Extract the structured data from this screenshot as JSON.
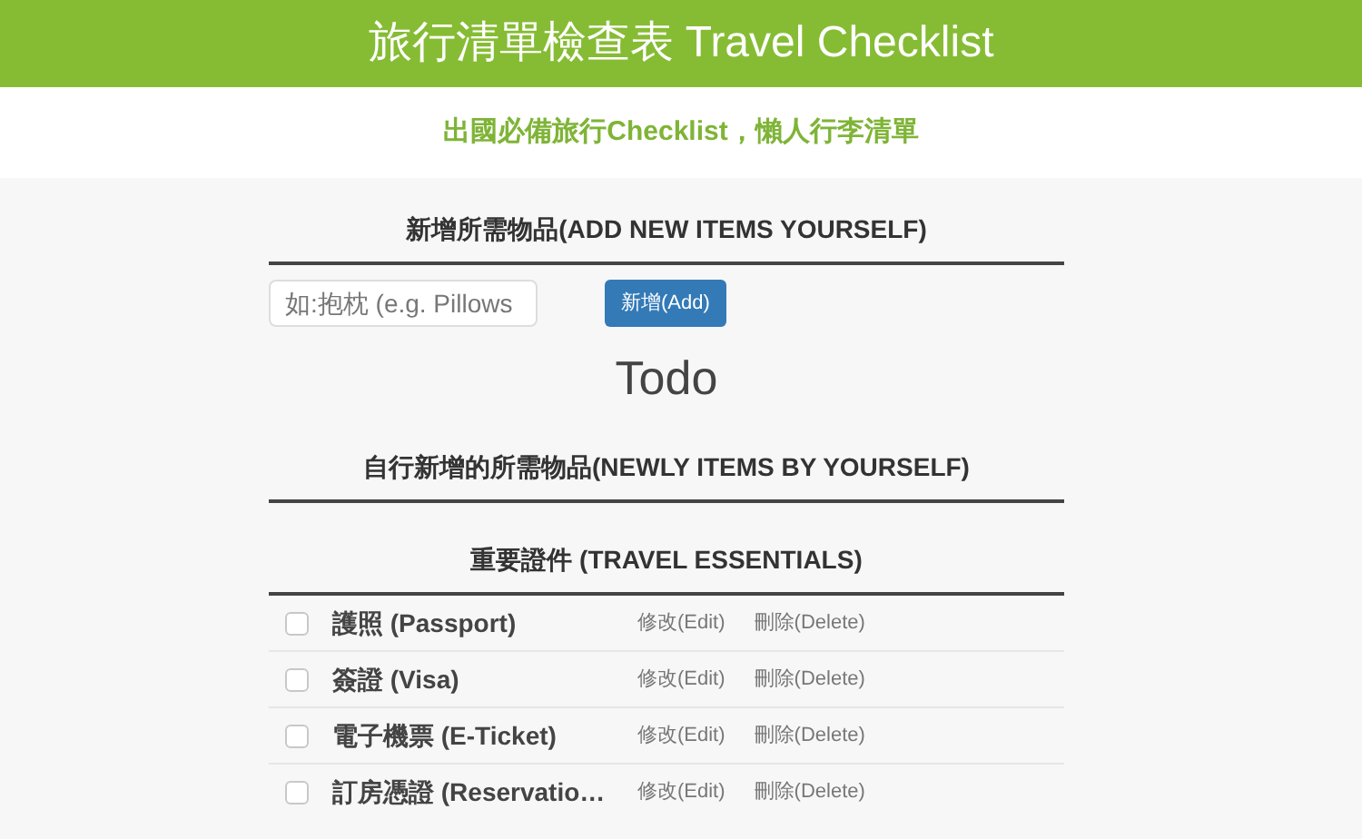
{
  "header": {
    "title": "旅行清單檢查表 Travel Checklist",
    "subtitle": "出國必備旅行Checklist，懶人行李清單"
  },
  "add_section": {
    "heading": "新增所需物品(ADD NEW ITEMS YOURSELF)",
    "input": {
      "placeholder": "如:抱枕 (e.g. Pillows"
    },
    "button": "新增(Add)"
  },
  "todo_title": "Todo",
  "custom_section": {
    "heading": "自行新增的所需物品(NEWLY ITEMS BY YOURSELF)"
  },
  "essentials": {
    "heading": "重要證件 (TRAVEL ESSENTIALS)",
    "items": [
      {
        "name": "護照 (Passport)",
        "checked": false,
        "edit": "修改(Edit)",
        "delete": "刪除(Delete)"
      },
      {
        "name": "簽證 (Visa)",
        "checked": false,
        "edit": "修改(Edit)",
        "delete": "刪除(Delete)"
      },
      {
        "name": "電子機票 (E-Ticket)",
        "checked": false,
        "edit": "修改(Edit)",
        "delete": "刪除(Delete)"
      },
      {
        "name": "訂房憑證 (Reservatio…",
        "checked": false,
        "edit": "修改(Edit)",
        "delete": "刪除(Delete)"
      }
    ]
  }
}
